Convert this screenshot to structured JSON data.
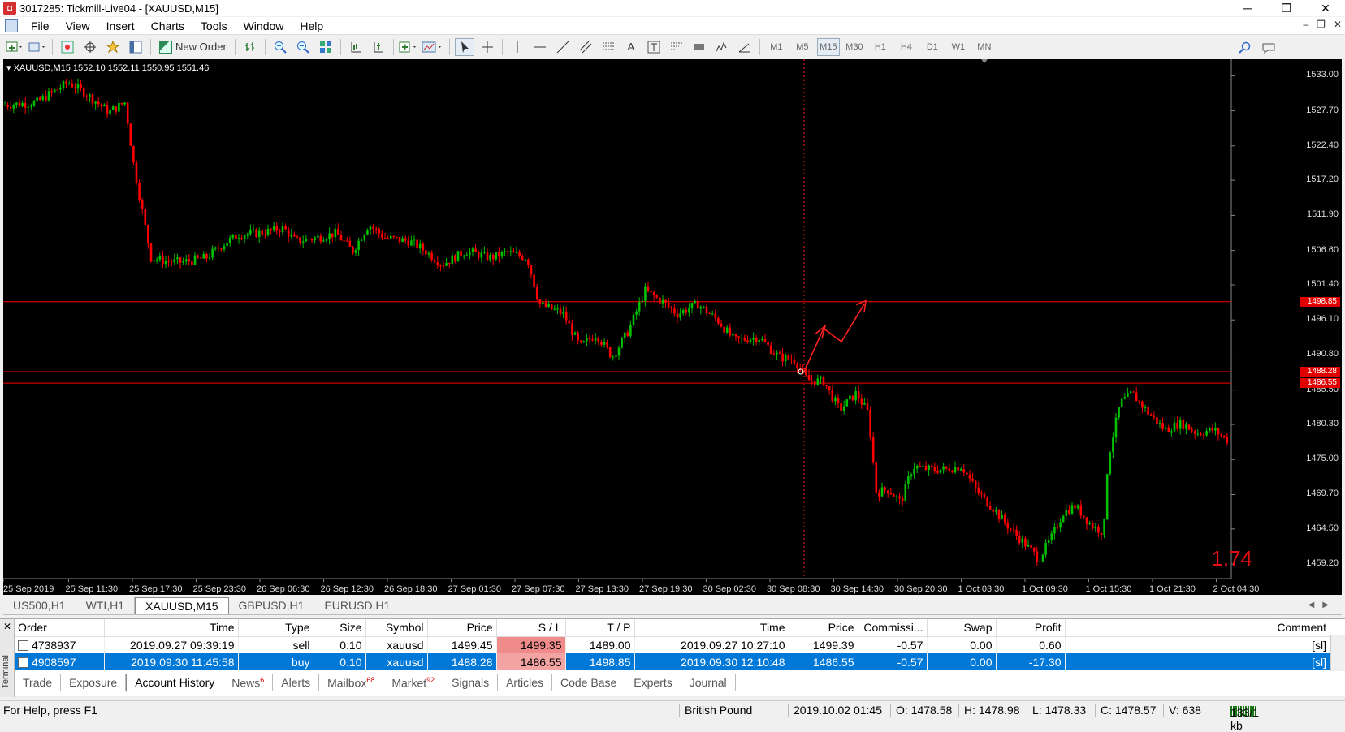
{
  "window": {
    "title": "3017285: Tickmill-Live04 - [XAUUSD,M15]",
    "controls": [
      "─",
      "❐",
      "✕"
    ]
  },
  "menu": {
    "items": [
      "File",
      "View",
      "Insert",
      "Charts",
      "Tools",
      "Window",
      "Help"
    ],
    "mdi_controls": [
      "–",
      "❐",
      "✕"
    ]
  },
  "toolbar": {
    "new_order_label": "New Order",
    "text_tool": "A",
    "timeframes": [
      "M1",
      "M5",
      "M15",
      "M30",
      "H1",
      "H4",
      "D1",
      "W1",
      "MN"
    ],
    "active_timeframe": "M15"
  },
  "chart": {
    "header": "XAUUSD,M15  1552.10 1552.11 1550.95 1551.46",
    "big_label": "1.74",
    "price_ticks": [
      "1533.00",
      "1527.70",
      "1522.40",
      "1517.20",
      "1511.90",
      "1506.60",
      "1501.40",
      "1496.10",
      "1490.80",
      "1485.50",
      "1480.30",
      "1475.00",
      "1469.70",
      "1464.50",
      "1459.20"
    ],
    "price_tags": [
      "1498.85",
      "1488.28",
      "1486.55"
    ],
    "time_ticks": [
      "25 Sep 2019",
      "25 Sep 11:30",
      "25 Sep 17:30",
      "25 Sep 23:30",
      "26 Sep 06:30",
      "26 Sep 12:30",
      "26 Sep 18:30",
      "27 Sep 01:30",
      "27 Sep 07:30",
      "27 Sep 13:30",
      "27 Sep 19:30",
      "30 Sep 02:30",
      "30 Sep 08:30",
      "30 Sep 14:30",
      "30 Sep 20:30",
      "1 Oct 03:30",
      "1 Oct 09:30",
      "1 Oct 15:30",
      "1 Oct 21:30",
      "2 Oct 04:30"
    ],
    "colors": {
      "bull": "#00c000",
      "bear": "#ff0000",
      "level": "#ff0000",
      "background": "#000000"
    }
  },
  "chart_tabs": {
    "items": [
      "US500,H1",
      "WTI,H1",
      "XAUUSD,M15",
      "GBPUSD,H1",
      "EURUSD,H1"
    ],
    "active": "XAUUSD,M15"
  },
  "terminal": {
    "side_label": "Terminal",
    "columns": [
      "Order",
      "Time",
      "Type",
      "Size",
      "Symbol",
      "Price",
      "S / L",
      "T / P",
      "Time",
      "Price",
      "Commissi...",
      "Swap",
      "Profit",
      "Comment"
    ],
    "rows": [
      [
        "4738937",
        "2019.09.27 09:39:19",
        "sell",
        "0.10",
        "xauusd",
        "1499.45",
        "1499.35",
        "1489.00",
        "2019.09.27 10:27:10",
        "1499.39",
        "-0.57",
        "0.00",
        "0.60",
        "[sl]"
      ],
      [
        "4908597",
        "2019.09.30 11:45:58",
        "buy",
        "0.10",
        "xauusd",
        "1488.28",
        "1486.55",
        "1498.85",
        "2019.09.30 12:10:48",
        "1486.55",
        "-0.57",
        "0.00",
        "-17.30",
        "[sl]"
      ]
    ],
    "tabs": [
      "Trade",
      "Exposure",
      "Account History",
      "News",
      "Alerts",
      "Mailbox",
      "Market",
      "Signals",
      "Articles",
      "Code Base",
      "Experts",
      "Journal"
    ],
    "badges": {
      "News": "6",
      "Mailbox": "68",
      "Market": "92"
    },
    "active_tab": "Account History"
  },
  "status": {
    "help": "For Help, press F1",
    "profile": "British Pound",
    "datetime": "2019.10.02 01:45",
    "open": "O: 1478.58",
    "high": "H: 1478.98",
    "low": "L: 1478.33",
    "close": "C: 1478.57",
    "volume": "V: 638",
    "traffic": "133/1 kb"
  }
}
